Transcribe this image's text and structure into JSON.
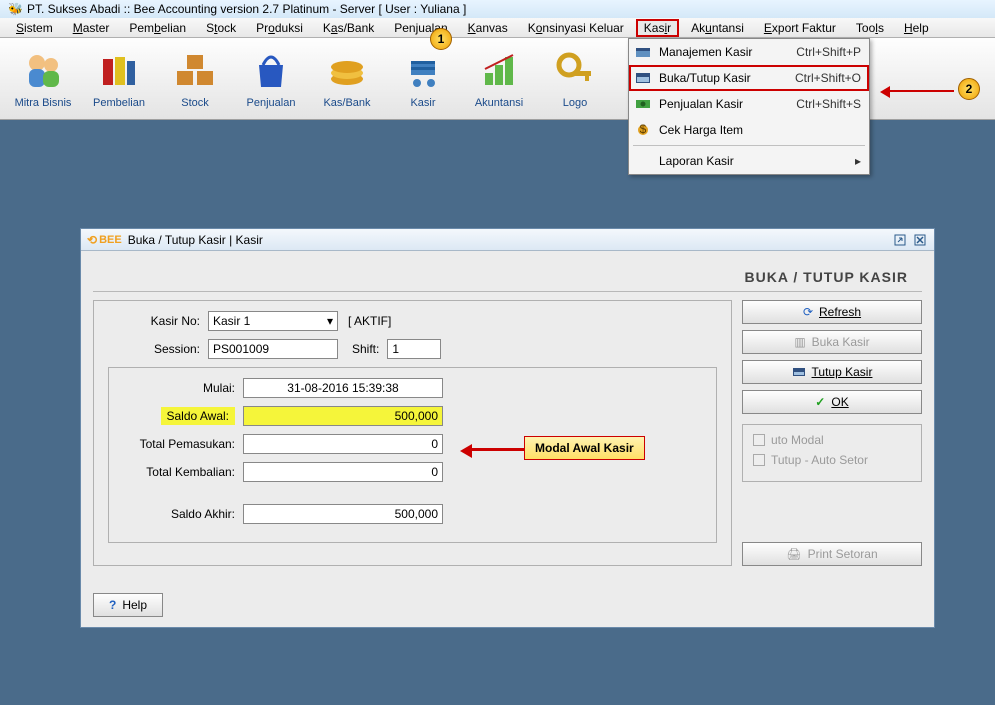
{
  "title_bar": "PT. Sukses Abadi :: Bee Accounting version 2.7 Platinum - Server  [ User : Yuliana ]",
  "menus": {
    "sistem": "Sistem",
    "master": "Master",
    "pembelian": "Pembelian",
    "stock": "Stock",
    "produksi": "Produksi",
    "kasbank": "Kas/Bank",
    "penjualan": "Penjualan",
    "kanvas": "Kanvas",
    "konsinyasi": "Konsinyasi Keluar",
    "kasir": "Kasir",
    "akuntansi": "Akuntansi",
    "export": "Export Faktur",
    "tools": "Tools",
    "help": "Help"
  },
  "toolbar": {
    "mitra": "Mitra Bisnis",
    "pembelian": "Pembelian",
    "stock": "Stock",
    "penjualan": "Penjualan",
    "kasbank": "Kas/Bank",
    "kasir": "Kasir",
    "akuntansi": "Akuntansi",
    "logo": "Logo"
  },
  "dropdown": {
    "manajemen": {
      "label": "Manajemen Kasir",
      "short": "Ctrl+Shift+P"
    },
    "buka": {
      "label": "Buka/Tutup Kasir",
      "short": "Ctrl+Shift+O"
    },
    "penjualan": {
      "label": "Penjualan Kasir",
      "short": "Ctrl+Shift+S"
    },
    "cek": {
      "label": "Cek Harga Item"
    },
    "laporan": {
      "label": "Laporan Kasir"
    }
  },
  "annot": {
    "one": "1",
    "two": "2"
  },
  "window": {
    "title": "Buka / Tutup Kasir | Kasir",
    "bee": "BEE",
    "header": "BUKA / TUTUP KASIR",
    "kasir_no_label": "Kasir No:",
    "kasir_no_value": "Kasir 1",
    "status": "[ AKTIF]",
    "session_label": "Session:",
    "session_value": "PS001009",
    "shift_label": "Shift:",
    "shift_value": "1",
    "mulai_label": "Mulai:",
    "mulai_value": "31-08-2016 15:39:38",
    "saldo_awal_label": "Saldo Awal:",
    "saldo_awal_value": "500,000",
    "total_pemasukan_label": "Total Pemasukan:",
    "total_pemasukan_value": "0",
    "total_kembalian_label": "Total Kembalian:",
    "total_kembalian_value": "0",
    "saldo_akhir_label": "Saldo Akhir:",
    "saldo_akhir_value": "500,000",
    "btn_refresh": "Refresh",
    "btn_buka": "Buka Kasir",
    "btn_tutup": "Tutup Kasir",
    "btn_ok": "OK",
    "chk_auto_modal": "uto Modal",
    "chk_auto_setor": "Tutup - Auto Setor",
    "btn_print": "Print Setoran",
    "btn_help": "Help"
  },
  "callout": "Modal Awal Kasir"
}
